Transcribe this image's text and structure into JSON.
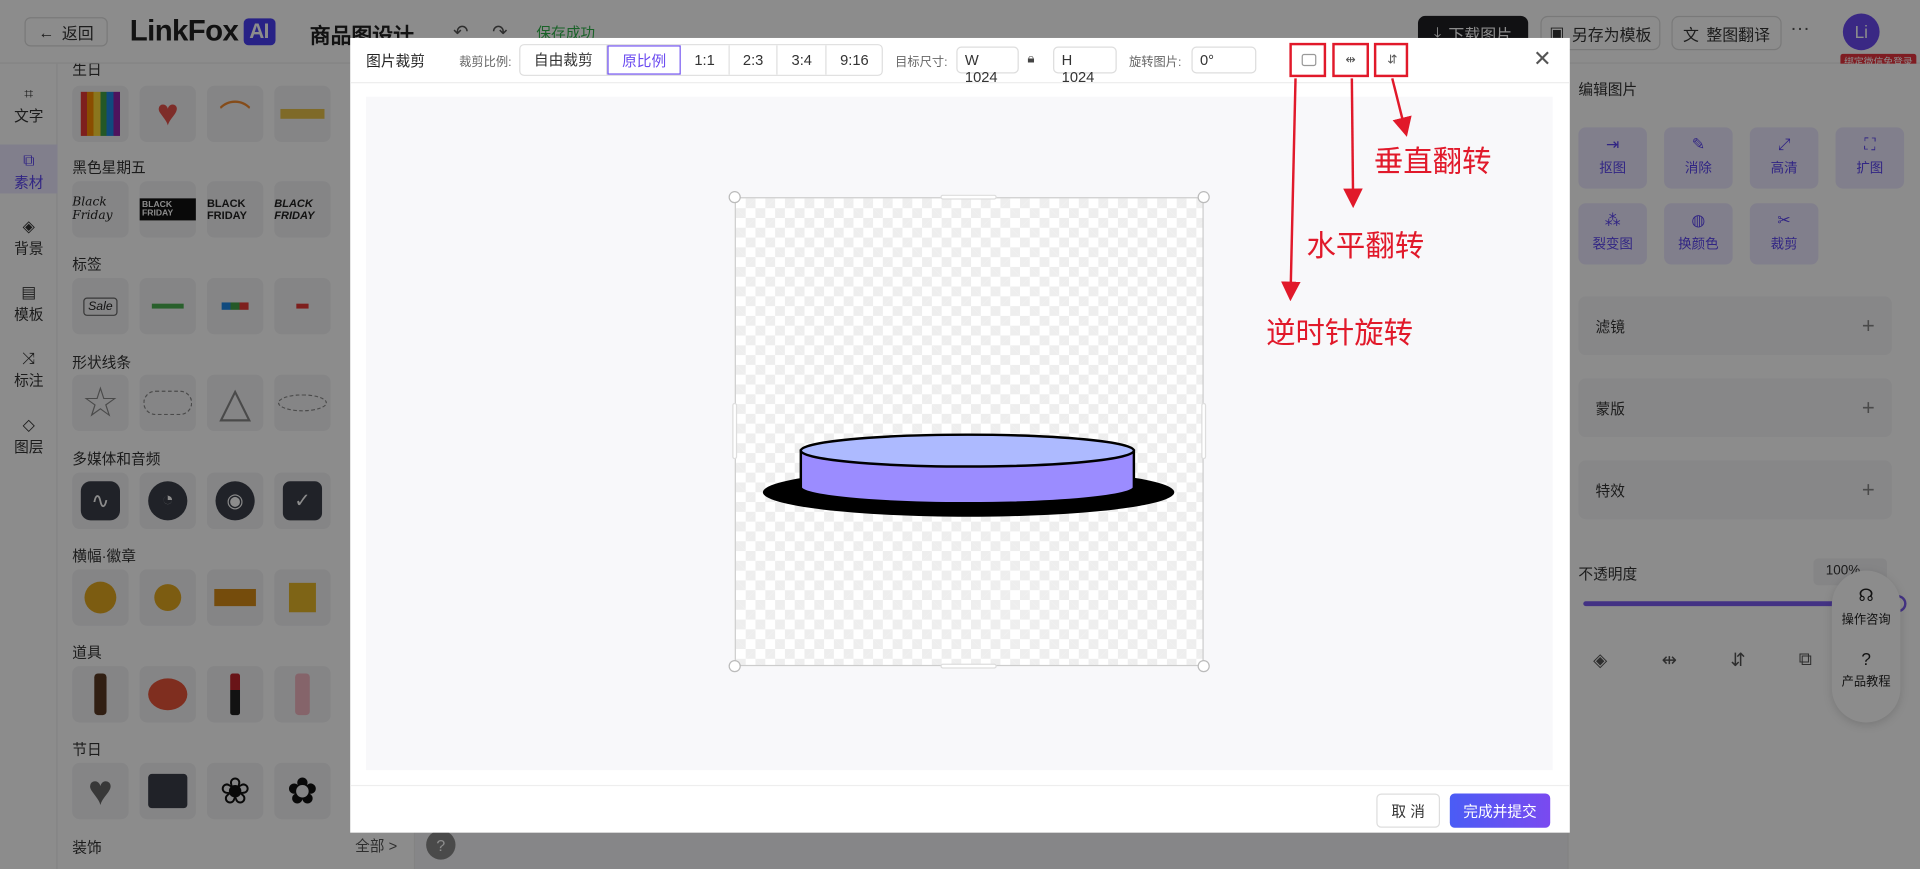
{
  "topbar": {
    "back_label": "返回",
    "logo_text": "LinkFox",
    "logo_ai": "AI",
    "project_title": "商品图设计",
    "save_status": "保存成功",
    "download_label": "下载图片",
    "save_template_label": "另存为模板",
    "translate_label": "整图翻译",
    "avatar_text": "Li",
    "bind_tag": "绑定微信免登录"
  },
  "leftrail": {
    "items": [
      {
        "label": "文字",
        "icon": "text-icon"
      },
      {
        "label": "素材",
        "icon": "material-icon"
      },
      {
        "label": "背景",
        "icon": "background-icon"
      },
      {
        "label": "模板",
        "icon": "template-icon"
      },
      {
        "label": "标注",
        "icon": "annotation-icon"
      },
      {
        "label": "图层",
        "icon": "layers-icon"
      }
    ],
    "active": "素材"
  },
  "panel": {
    "categories": [
      "生日",
      "黑色星期五",
      "标签",
      "形状线条",
      "多媒体和音频",
      "横幅·徽章",
      "道具",
      "节日",
      "装饰"
    ],
    "bf_texts": [
      "Black Friday",
      "BLACK FRIDAY",
      "BLACK FRIDAY",
      "BLACK FRIDAY"
    ],
    "sale_text": "Sale",
    "footer_all": "全部 >",
    "help": "?"
  },
  "rightpanel": {
    "title": "编辑图片",
    "tools": [
      "抠图",
      "消除",
      "高清",
      "扩图",
      "裂变图",
      "换颜色",
      "裁剪"
    ],
    "rows": [
      "滤镜",
      "蒙版",
      "特效"
    ],
    "opacity_label": "不透明度",
    "opacity_value": "100%",
    "opacity": 1.0
  },
  "floatbox": {
    "consult": "操作咨询",
    "tutorial": "产品教程"
  },
  "dialog": {
    "title": "图片裁剪",
    "ratio_label": "裁剪比例:",
    "ratios": [
      "自由裁剪",
      "原比例",
      "1:1",
      "2:3",
      "3:4",
      "9:16"
    ],
    "selected_ratio": "原比例",
    "target_size_label": "目标尺寸:",
    "width_value": "W 1024",
    "height_value": "H 1024",
    "rotate_label": "旋转图片:",
    "rotate_value": "0°",
    "cancel_label": "取 消",
    "submit_label": "完成并提交"
  },
  "annotations": {
    "rotate_ccw": "逆时针旋转",
    "flip_horizontal": "水平翻转",
    "flip_vertical": "垂直翻转",
    "color": "#e1192a"
  },
  "colors": {
    "accent": "#5a44f0",
    "podium_top": "#adbaff",
    "podium_side": "#9b8cff",
    "shadow": "#000000"
  }
}
